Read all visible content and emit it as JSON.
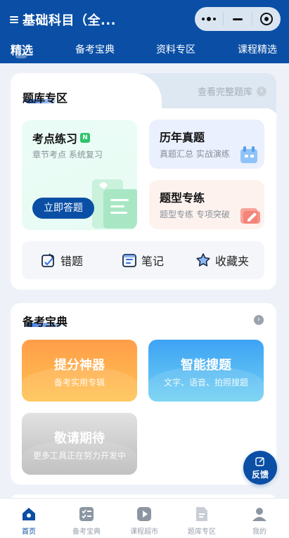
{
  "header": {
    "title": "基础科目（全...",
    "tabs": [
      {
        "label": "精选",
        "active": true
      },
      {
        "label": "备考宝典",
        "active": false
      },
      {
        "label": "资料专区",
        "active": false
      },
      {
        "label": "课程精选",
        "active": false
      }
    ]
  },
  "question_bank": {
    "title": "题库专区",
    "more_label": "查看完整题库",
    "practice": {
      "title": "考点练习",
      "badge": "N",
      "subtitle": "章节考点 系统复习",
      "button": "立即答题"
    },
    "past_exams": {
      "title": "历年真题",
      "subtitle": "真题汇总 实战演练"
    },
    "type_drill": {
      "title": "题型专练",
      "subtitle": "题型专练 专项突破"
    },
    "quick": [
      {
        "label": "错题",
        "icon": "wrong-question-icon"
      },
      {
        "label": "笔记",
        "icon": "notes-icon"
      },
      {
        "label": "收藏夹",
        "icon": "star-icon"
      }
    ]
  },
  "prep_guide": {
    "title": "备考宝典",
    "tools": [
      {
        "title": "提分神器",
        "subtitle": "备考实用专辑"
      },
      {
        "title": "智能搜题",
        "subtitle": "文字、语音、拍照搜题"
      },
      {
        "title": "敬请期待",
        "subtitle": "更多工具正在努力开发中"
      }
    ]
  },
  "feedback": {
    "label": "反馈"
  },
  "bottom_nav": [
    {
      "label": "首页",
      "active": true
    },
    {
      "label": "备考宝典",
      "active": false
    },
    {
      "label": "课程超市",
      "active": false
    },
    {
      "label": "题库专区",
      "active": false
    },
    {
      "label": "我的",
      "active": false
    }
  ],
  "colors": {
    "brand": "#0a4fa5",
    "orange": "#ffae4c",
    "blue": "#4aaef5",
    "gray": "#c8c8c8"
  }
}
